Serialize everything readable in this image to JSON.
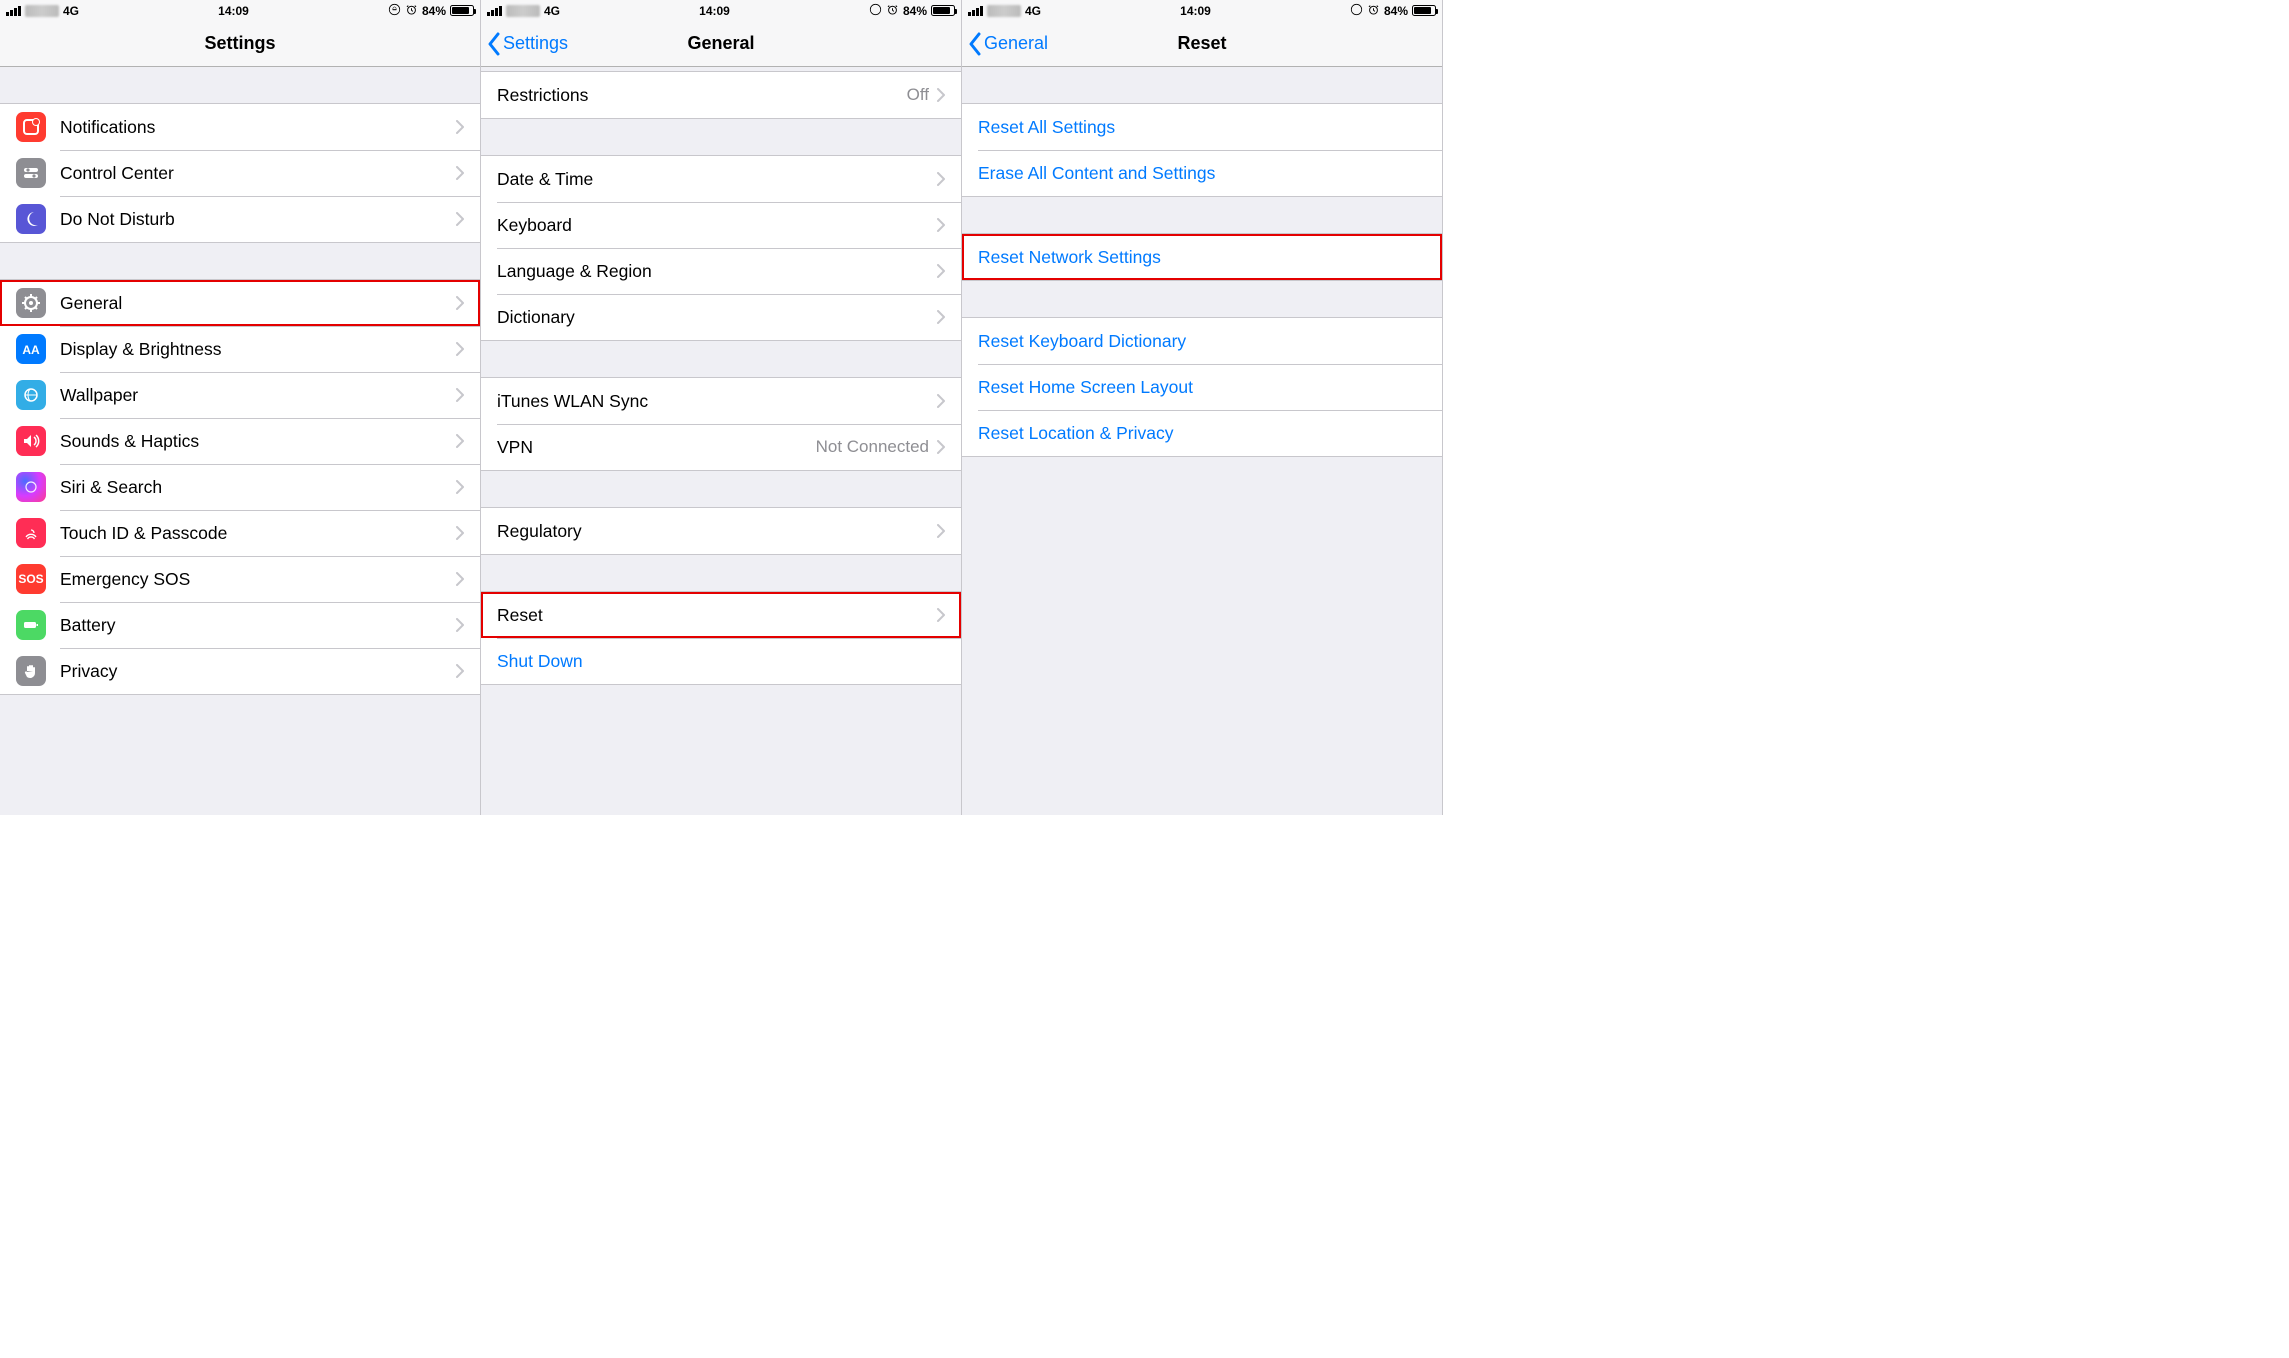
{
  "status": {
    "network": "4G",
    "time": "14:09",
    "battery_percent": "84%",
    "battery_fill_pct": 84
  },
  "panel1": {
    "title": "Settings",
    "section1": [
      {
        "label": "Notifications"
      },
      {
        "label": "Control Center"
      },
      {
        "label": "Do Not Disturb"
      }
    ],
    "section2": [
      {
        "label": "General"
      },
      {
        "label": "Display & Brightness"
      },
      {
        "label": "Wallpaper"
      },
      {
        "label": "Sounds & Haptics"
      },
      {
        "label": "Siri & Search"
      },
      {
        "label": "Touch ID & Passcode"
      },
      {
        "label": "Emergency SOS"
      },
      {
        "label": "Battery"
      },
      {
        "label": "Privacy"
      }
    ]
  },
  "panel2": {
    "back": "Settings",
    "title": "General",
    "rows": {
      "restrictions": {
        "label": "Restrictions",
        "detail": "Off"
      },
      "datetime": {
        "label": "Date & Time"
      },
      "keyboard": {
        "label": "Keyboard"
      },
      "language": {
        "label": "Language & Region"
      },
      "dictionary": {
        "label": "Dictionary"
      },
      "itunes": {
        "label": "iTunes WLAN Sync"
      },
      "vpn": {
        "label": "VPN",
        "detail": "Not Connected"
      },
      "regulatory": {
        "label": "Regulatory"
      },
      "reset": {
        "label": "Reset"
      },
      "shutdown": {
        "label": "Shut Down"
      }
    }
  },
  "panel3": {
    "back": "General",
    "title": "Reset",
    "rows": {
      "reset_all": "Reset All Settings",
      "erase": "Erase All Content and Settings",
      "reset_network": "Reset Network Settings",
      "reset_keyboard": "Reset Keyboard Dictionary",
      "reset_home": "Reset Home Screen Layout",
      "reset_location": "Reset Location & Privacy"
    }
  }
}
